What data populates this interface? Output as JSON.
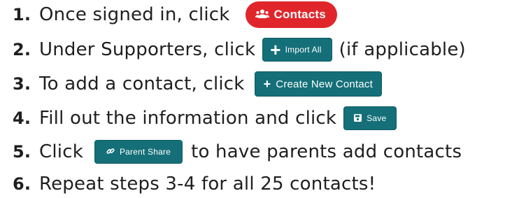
{
  "steps": [
    {
      "number": "1.",
      "before": "Once signed in, click",
      "button": {
        "label": "Contacts",
        "icon": "people-icon",
        "style": "red-pill"
      },
      "after": ""
    },
    {
      "number": "2.",
      "before": "Under Supporters, click",
      "button": {
        "label": "Import All",
        "icon": "plus-icon",
        "style": "teal"
      },
      "after": "(if applicable)"
    },
    {
      "number": "3.",
      "before": "To add a contact, click",
      "button": {
        "label": "Create New Contact",
        "icon": "plus-icon",
        "style": "teal"
      },
      "after": ""
    },
    {
      "number": "4.",
      "before": "Fill out the information and click",
      "button": {
        "label": "Save",
        "icon": "save-icon",
        "style": "teal"
      },
      "after": ""
    },
    {
      "number": "5.",
      "before": "Click",
      "button": {
        "label": "Parent Share",
        "icon": "link-icon",
        "style": "teal"
      },
      "after": "to have parents add contacts"
    },
    {
      "number": "6.",
      "before": "Repeat steps 3-4 for all 25 contacts!",
      "after": ""
    }
  ],
  "colors": {
    "red_button": "#e0262b",
    "teal_button": "#146f78",
    "text": "#1f1f1f"
  }
}
